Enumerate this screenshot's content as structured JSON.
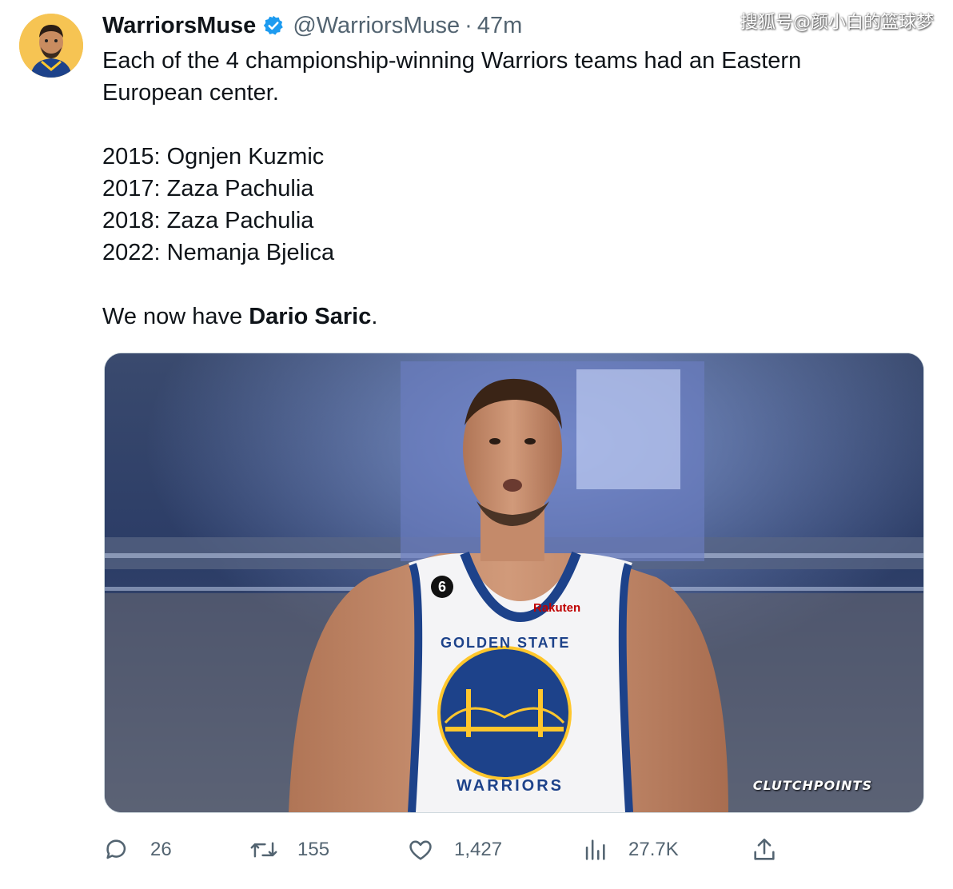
{
  "author": {
    "display_name": "WarriorsMuse",
    "handle": "@WarriorsMuse",
    "separator": "·",
    "time": "47m",
    "verified": true
  },
  "watermark": "搜狐号@颜小白的篮球梦",
  "tweet": {
    "intro": "Each of the 4 championship-winning Warriors teams had an Eastern European center.",
    "list": [
      "2015: Ognjen Kuzmic",
      "2017: Zaza Pachulia",
      "2018: Zaza Pachulia",
      "2022: Nemanja Bjelica"
    ],
    "closing_prefix": "We now have ",
    "closing_bold": "Dario Saric",
    "closing_suffix": "."
  },
  "media": {
    "alt": "Player in Golden State Warriors jersey in an arena",
    "jersey_number": "6",
    "jersey_sponsor": "Rakuten",
    "jersey_text_top": "GOLDEN STATE",
    "jersey_text_bottom": "WARRIORS",
    "credit": "CLUTCHPOINTS"
  },
  "actions": {
    "replies": "26",
    "retweets": "155",
    "likes": "1,427",
    "views": "27.7K"
  },
  "colors": {
    "text": "#0f1419",
    "secondary": "#536471",
    "verified_blue": "#1d9bf0",
    "warriors_blue": "#1d428a",
    "warriors_gold": "#ffc72c"
  },
  "icons": {
    "reply": "reply-icon",
    "retweet": "retweet-icon",
    "like": "like-icon",
    "views": "views-icon",
    "share": "share-icon",
    "verified": "verified-badge-icon"
  }
}
